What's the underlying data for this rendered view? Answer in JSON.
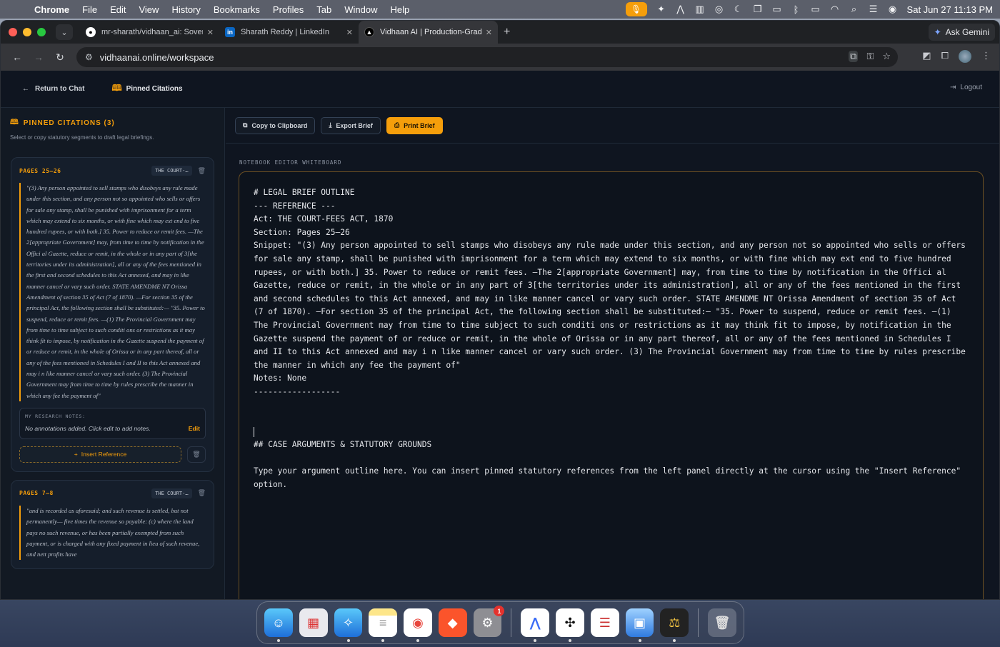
{
  "menubar": {
    "app": "Chrome",
    "items": [
      "File",
      "Edit",
      "View",
      "History",
      "Bookmarks",
      "Profiles",
      "Tab",
      "Window",
      "Help"
    ],
    "datetime": "Sat Jun 27  11:13 PM"
  },
  "browser": {
    "tabs": [
      {
        "title": "mr-sharath/vidhaan_ai: Sover",
        "favicon": "github-icon"
      },
      {
        "title": "Sharath Reddy | LinkedIn",
        "favicon": "linkedin-icon"
      },
      {
        "title": "Vidhaan AI | Production-Grad",
        "favicon": "vidhaan-icon",
        "active": true
      }
    ],
    "ask_gemini": "Ask Gemini",
    "url": "vidhaanai.online/workspace"
  },
  "appbar": {
    "return_label": "Return to Chat",
    "pinned_label": "Pinned Citations",
    "logout_label": "Logout"
  },
  "sidebar": {
    "title": "PINNED CITATIONS (3)",
    "subtitle": "Select or copy statutory segments to draft legal briefings.",
    "cards": [
      {
        "pages": "PAGES 25–26",
        "act_badge": "THE COURT-…",
        "snippet": "\"(3) Any person appointed to sell stamps who disobeys any rule made under this section, and any person not so appointed who sells or offers for sale any stamp, shall be punished with imprisonment for a term which may extend to six months, or with fine which may ext end to five hundred rupees, or with both.] 35. Power to reduce or remit fees. —The 2[appropriate Government] may, from time to time by notification in the Offici al Gazette, reduce or remit, in the whole or in any part of 3[the territories under its administration], all or any of the fees mentioned in the first and second schedules to this Act annexed, and may in like manner cancel or vary such order. STATE AMENDME NT Orissa Amendment of section 35 of Act (7 of 1870). —For section 35 of the principal Act, the following section shall be substituted:— \"35. Power to suspend, reduce or remit fees. —(1) The Provincial Government may from time to time subject to such conditi ons or restrictions as it may think fit to impose, by notification in the Gazette suspend the payment of or reduce or remit, in the whole of Orissa or in any part thereof, all or any of the fees mentioned in Schedules I and II to this Act annexed and may i n like manner cancel or vary such order. (3) The Provincial Government may from time to time by rules prescribe the manner in which any fee the payment of\"",
        "notes_label": "MY RESEARCH NOTES:",
        "notes_text": "No annotations added. Click edit to add notes.",
        "edit_label": "Edit",
        "insert_label": "Insert Reference"
      },
      {
        "pages": "PAGES 7–8",
        "act_badge": "THE COURT-…",
        "snippet": "\"and is recorded as aforesaid; and such revenue is settled, but not permanently— five times the revenue so payable: (c) where the land pays no such revenue, or has been partially exempted from such payment, or is charged with any fixed payment in lieu of such revenue, and nett profits have"
      }
    ]
  },
  "main": {
    "buttons": {
      "copy": "Copy to Clipboard",
      "export": "Export Brief",
      "print": "Print Brief"
    },
    "editor_label": "NOTEBOOK EDITOR WHITEBOARD",
    "editor_before_caret": "# LEGAL BRIEF OUTLINE\n--- REFERENCE ---\nAct: THE COURT-FEES ACT, 1870\nSection: Pages 25–26\nSnippet: \"(3) Any person appointed to sell stamps who disobeys any rule made under this section, and any person not so appointed who sells or offers for sale any stamp, shall be punished with imprisonment for a term which may extend to six months, or with fine which may ext end to five hundred rupees, or with both.] 35. Power to reduce or remit fees. —The 2[appropriate Government] may, from time to time by notification in the Offici al Gazette, reduce or remit, in the whole or in any part of 3[the territories under its administration], all or any of the fees mentioned in the first and second schedules to this Act annexed, and may in like manner cancel or vary such order. STATE AMENDME NT Orissa Amendment of section 35 of Act (7 of 1870). —For section 35 of the principal Act, the following section shall be substituted:— \"35. Power to suspend, reduce or remit fees. —(1) The Provincial Government may from time to time subject to such conditi ons or restrictions as it may think fit to impose, by notification in the Gazette suspend the payment of or reduce or remit, in the whole of Orissa or in any part thereof, all or any of the fees mentioned in Schedules I and II to this Act annexed and may i n like manner cancel or vary such order. (3) The Provincial Government may from time to time by rules prescribe the manner in which any fee the payment of\"\nNotes: None\n------------------\n\n\n",
    "editor_after_caret": "\n## CASE ARGUMENTS & STATUTORY GROUNDS\n\nType your argument outline here. You can insert pinned statutory references from the left panel directly at the cursor using the \"Insert Reference\" option."
  },
  "dock": {
    "apps": [
      "finder-icon",
      "launchpad-icon",
      "safari-icon",
      "notes-icon",
      "chrome-icon",
      "brave-icon",
      "system-settings-icon",
      "arc-icon",
      "perplexity-icon",
      "textedit-icon",
      "preview-icon",
      "terminal-icon",
      "trash-icon"
    ],
    "settings_badge": "1"
  }
}
